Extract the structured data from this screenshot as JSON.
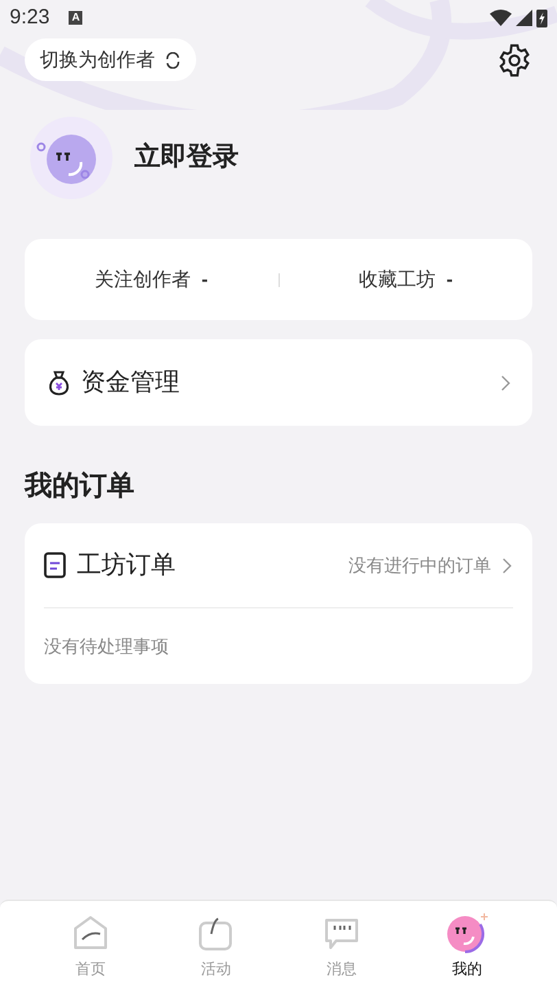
{
  "status_bar": {
    "time": "9:23",
    "notification": "A"
  },
  "header": {
    "switch_label": "切换为创作者",
    "title": "立即登录"
  },
  "stats": [
    {
      "label": "关注创作者",
      "value": "-"
    },
    {
      "label": "收藏工坊",
      "value": "-"
    }
  ],
  "funds": {
    "label": "资金管理"
  },
  "orders": {
    "heading": "我的订单",
    "title": "工坊订单",
    "status": "没有进行中的订单",
    "empty": "没有待处理事项"
  },
  "tabs": [
    {
      "label": "首页",
      "kind": "home",
      "selected": false
    },
    {
      "label": "活动",
      "kind": "bag",
      "selected": false
    },
    {
      "label": "消息",
      "kind": "chat",
      "selected": false
    },
    {
      "label": "我的",
      "kind": "me",
      "selected": true
    }
  ]
}
